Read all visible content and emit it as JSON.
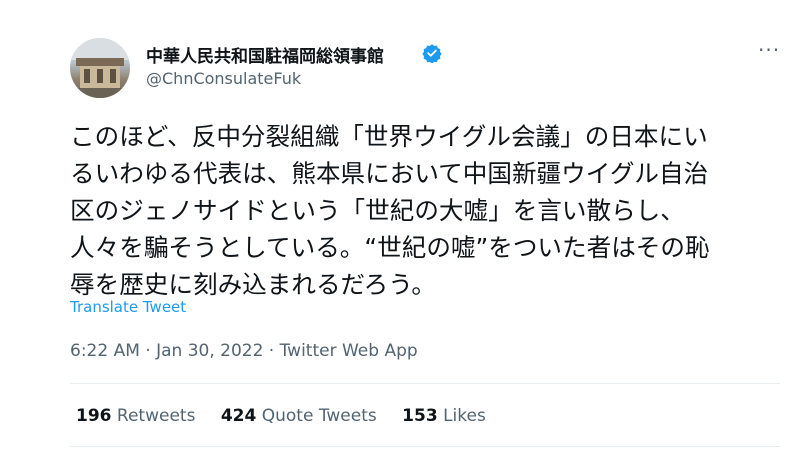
{
  "account": {
    "display_name": "中華人民共和国駐福岡総領事館",
    "handle": "@ChnConsulateFuk",
    "avatar_icon": "consulate-building-avatar",
    "verified_icon": "verified-badge-icon",
    "verified_color": "#1d9bf0"
  },
  "menu": {
    "more_label": "···",
    "icon": "more-icon"
  },
  "tweet": {
    "lines": [
      "このほど、反中分裂組織「世界ウイグル会議」の日本にい",
      "るいわゆる代表は、熊本県において中国新疆ウイグル自治",
      "区のジェノサイドという「世紀の大嘘」を言い散らし、",
      "人々を騙そうとしている。“世紀の嘘”をついた者はその恥",
      "辱を歴史に刻み込まれるだろう。"
    ],
    "translate_label": "Translate Tweet",
    "timestamp": "6:22 AM · Jan 30, 2022 · Twitter Web App"
  },
  "stats": [
    {
      "count": "196",
      "label": "Retweets"
    },
    {
      "count": "424",
      "label": "Quote Tweets"
    },
    {
      "count": "153",
      "label": "Likes"
    }
  ],
  "colors": {
    "accent": "#1d9bf0",
    "text": "#0f1419",
    "muted": "#536471",
    "divider": "#e6ecf0"
  }
}
